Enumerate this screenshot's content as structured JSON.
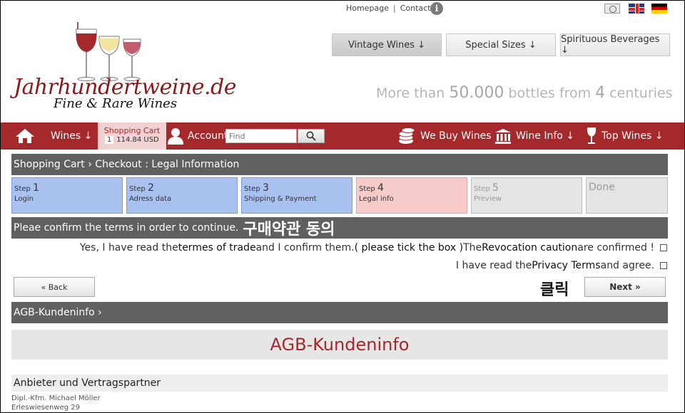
{
  "top_links": {
    "homepage": "Homepage",
    "separator": "|",
    "contact": "Contact"
  },
  "logo": {
    "name": "Jahrhundertweine.de",
    "subtitle": "Fine & Rare Wines"
  },
  "category_buttons": [
    {
      "label": "Vintage Wines ↓"
    },
    {
      "label": "Special Sizes ↓"
    },
    {
      "label": "Spirituous Beverages ↓"
    }
  ],
  "tagline": {
    "pre": "More than ",
    "count": "50.000",
    "mid": " bottles from ",
    "centuries": "4",
    "post": " centuries"
  },
  "nav": {
    "wines": "Wines ↓",
    "cart_title": "Shopping Cart",
    "cart_count": "1",
    "cart_amount": "114.84 USD",
    "account": "Account",
    "search_placeholder": "Find",
    "we_buy": "We Buy Wines",
    "wine_info": "Wine Info ↓",
    "top_wines": "Top Wines ↓"
  },
  "breadcrumb": "Shopping Cart › Checkout : Legal Information",
  "steps": [
    {
      "prefix": "Step",
      "num": "1",
      "label": "Login"
    },
    {
      "prefix": "Step",
      "num": "2",
      "label": "Adress data"
    },
    {
      "prefix": "Step",
      "num": "3",
      "label": "Shipping & Payment"
    },
    {
      "prefix": "Step",
      "num": "4",
      "label": "Legal info"
    },
    {
      "prefix": "Step",
      "num": "5",
      "label": "Preview"
    },
    {
      "prefix": "",
      "num": "",
      "label": "Done"
    }
  ],
  "confirm": {
    "text": "Pleae confirm the terms in order to continue.",
    "annotation_kr": "구매약관 동의"
  },
  "terms": {
    "line1": {
      "a": "Yes, I have read the ",
      "b": "termes of trade",
      "c": " and I confirm them. ",
      "d": "( please tick the box )",
      "e": " The ",
      "f": "Revocation caution",
      "g": " are confirmed !"
    },
    "line2": {
      "a": "I have read the ",
      "b": "Privacy Terms",
      "c": " and agree."
    }
  },
  "buttons": {
    "back": "« Back",
    "next": "Next »"
  },
  "click_annotation_kr": "클릭",
  "agb": {
    "bar": "AGB-Kundeninfo ›",
    "title": "AGB-Kundeninfo"
  },
  "anbieter": {
    "heading": "Anbieter und Vertragspartner",
    "line1": "Dipl.-Kfm. Michael Möller",
    "line2": "Erleswiesenweg 29"
  },
  "colors": {
    "brand_red": "#a5282b",
    "bar_grey": "#606060",
    "step_done": "#a9c1ee",
    "step_current": "#f8cbcb"
  }
}
